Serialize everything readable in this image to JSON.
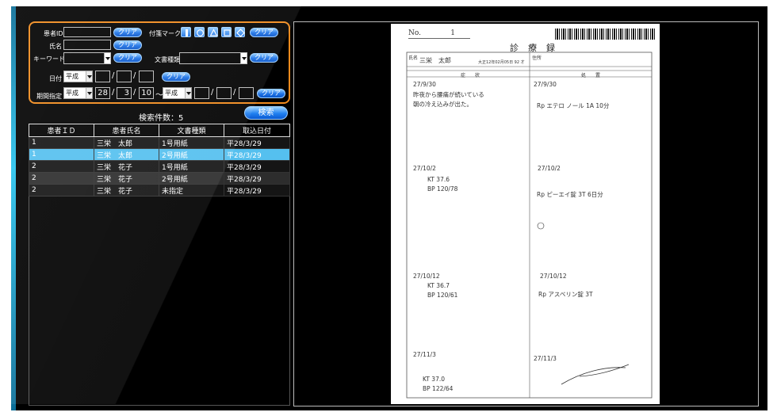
{
  "search": {
    "patient_id_label": "患者ID",
    "patient_name_label": "氏名",
    "keyword_label": "キーワード",
    "attach_mark_label": "付箋マーク",
    "doc_type_label": "文書種類",
    "date_label": "日付",
    "period_label": "期間指定",
    "clear_label": "クリア",
    "era": "平成",
    "period_from": {
      "year": "28",
      "month": "3",
      "day": "10"
    },
    "tilde": "～",
    "search_label": "検索"
  },
  "results": {
    "count_text": "検索件数：5",
    "headers": [
      "患者ＩＤ",
      "患者氏名",
      "文書種類",
      "取込日付"
    ],
    "rows": [
      [
        "1",
        "三栄　太郎",
        "1号用紙",
        "平28/3/29"
      ],
      [
        "1",
        "三栄　太郎",
        "2号用紙",
        "平28/3/29"
      ],
      [
        "2",
        "三栄　花子",
        "1号用紙",
        "平28/3/29"
      ],
      [
        "2",
        "三栄　花子",
        "2号用紙",
        "平28/3/29"
      ],
      [
        "2",
        "三栄　花子",
        "未指定",
        "平28/3/29"
      ]
    ]
  },
  "document": {
    "no_label": "No.",
    "no_value": "1",
    "title": "診療録",
    "name_label": "氏名",
    "patient_name": "三栄　太郎",
    "birth": "大正12年02月05日 92 才",
    "address_label": "住所",
    "col_left": "症　　状",
    "col_right": "処　　置",
    "notes_left": [
      "27/9/30",
      "昨夜から腰痛が続いている",
      "朝の冷え込みが出た。",
      "27/10/2",
      "KT 37.6",
      "BP 120/78",
      "27/10/12",
      "KT 36.7",
      "BP 120/61",
      "27/11/3",
      "KT 37.0",
      "BP 122/64"
    ],
    "notes_right": [
      "27/9/30",
      "Rp エテロ ノール 1A 10分",
      "27/10/2",
      "Rp ピーエイ錠 3T 6日分",
      "27/10/12",
      "Rp アスベリン錠 3T",
      "27/11/3"
    ]
  }
}
